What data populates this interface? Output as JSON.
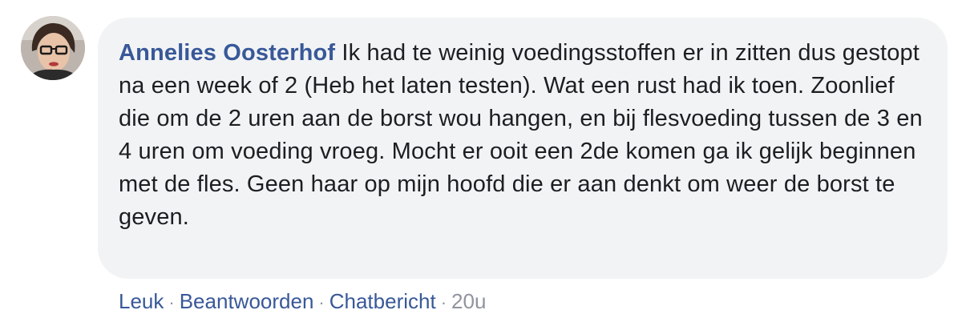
{
  "comment": {
    "author": "Annelies Oosterhof",
    "body": "Ik had te weinig voedingsstoffen er in zitten dus gestopt na een week of 2 (Heb het laten testen). Wat een rust had ik toen. Zoonlief die om de 2 uren aan de borst wou hangen, en bij flesvoeding tussen de 3 en 4 uren om voeding vroeg. Mocht er ooit een 2de komen ga ik gelijk beginnen met de fles. Geen haar op mijn hoofd die er aan denkt om weer de borst te geven."
  },
  "actions": {
    "like_label": "Leuk",
    "reply_label": "Beantwoorden",
    "message_label": "Chatbericht",
    "separator": "·",
    "timestamp": "20u"
  },
  "colors": {
    "author_link": "#385898",
    "bubble_bg": "#f2f3f5",
    "meta_gray": "#90949c"
  }
}
